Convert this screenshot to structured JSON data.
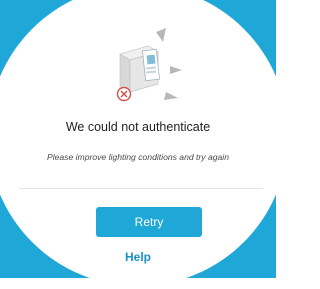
{
  "dialog": {
    "title": "We could not authenticate",
    "hint": "Please improve lighting conditions and try again",
    "retry_label": "Retry",
    "help_label": "Help"
  },
  "icons": {
    "illustration": "document-scan-icon",
    "error": "error-circle-icon"
  },
  "colors": {
    "accent": "#1ea7d7",
    "help_text": "#1a8fc4",
    "error": "#d4504a"
  }
}
